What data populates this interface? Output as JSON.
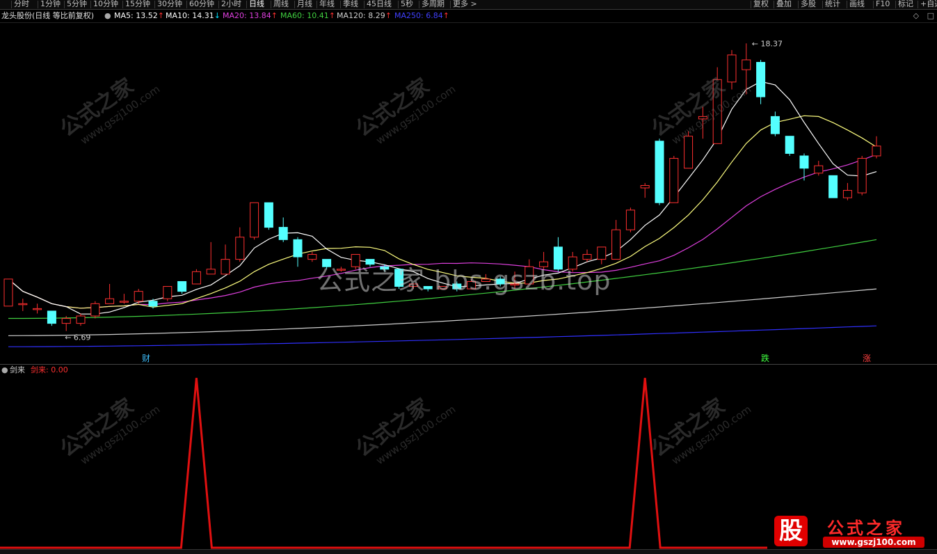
{
  "toolbar": {
    "periods": [
      {
        "label": "分时",
        "active": false
      },
      {
        "label": "1分钟",
        "active": false
      },
      {
        "label": "5分钟",
        "active": false
      },
      {
        "label": "10分钟",
        "active": false
      },
      {
        "label": "15分钟",
        "active": false
      },
      {
        "label": "30分钟",
        "active": false
      },
      {
        "label": "60分钟",
        "active": false
      },
      {
        "label": "2小时",
        "active": false
      },
      {
        "label": "日线",
        "active": true
      },
      {
        "label": "周线",
        "active": false
      },
      {
        "label": "月线",
        "active": false
      },
      {
        "label": "年线",
        "active": false
      },
      {
        "label": "季线",
        "active": false
      },
      {
        "label": "45日线",
        "active": false
      },
      {
        "label": "5秒",
        "active": false
      },
      {
        "label": "多周期",
        "active": false
      },
      {
        "label": "更多 >",
        "active": false
      }
    ],
    "right_items": [
      "复权",
      "叠加",
      "多股",
      "统计",
      "画线",
      "F10",
      "标记",
      "+自选"
    ]
  },
  "info": {
    "stock": "龙头股份(日线 等比前复权)",
    "ma": [
      {
        "label": "MA5: 13.52",
        "arrow": "↑",
        "dir": "up",
        "color": "#ffffff"
      },
      {
        "label": "MA10: 14.31",
        "arrow": "↓",
        "dir": "down",
        "color": "#ffffff"
      },
      {
        "label": "MA20: 13.84",
        "arrow": "↑",
        "dir": "up",
        "color": "#e040e0"
      },
      {
        "label": "MA60: 10.41",
        "arrow": "↑",
        "dir": "up",
        "color": "#40d040"
      },
      {
        "label": "MA120: 8.29",
        "arrow": "↑",
        "dir": "up",
        "color": "#d0d0d0"
      },
      {
        "label": "MA250: 6.84",
        "arrow": "↑",
        "dir": "up",
        "color": "#4040ff"
      }
    ]
  },
  "annotations": {
    "high": "18.37",
    "low": "6.69"
  },
  "markers": {
    "cai": "财",
    "die": "跌",
    "zhang": "涨"
  },
  "indicator": {
    "name": "剑来",
    "value_label": "剑来: 0.00"
  },
  "watermark": {
    "center": "公式之家 bbs.gszb.top",
    "tile_title": "公式之家",
    "tile_url": "www.gszj100.com"
  },
  "logo": {
    "badge": "股",
    "title": "公式之家",
    "url": "www.gszj100.com"
  },
  "colors": {
    "up": "#ff3030",
    "down": "#54ffff",
    "ma5": "#ffffff",
    "ma10": "#ffff80",
    "ma20": "#e040e0",
    "ma60": "#40d040",
    "ma120": "#d0d0d0",
    "ma250": "#3030ff",
    "indicator": "#e01010"
  },
  "chart_data": {
    "type": "candlestick",
    "price_range": [
      6.0,
      19.0
    ],
    "candles": [
      {
        "o": 7.7,
        "c": 8.8,
        "h": 8.8,
        "l": 7.7
      },
      {
        "o": 7.8,
        "c": 7.8,
        "h": 8.0,
        "l": 7.5
      },
      {
        "o": 7.6,
        "c": 7.6,
        "h": 7.8,
        "l": 7.4
      },
      {
        "o": 7.5,
        "c": 7.0,
        "h": 7.5,
        "l": 6.9
      },
      {
        "o": 7.0,
        "c": 7.2,
        "h": 7.3,
        "l": 6.69
      },
      {
        "o": 7.0,
        "c": 7.3,
        "h": 7.4,
        "l": 6.9
      },
      {
        "o": 7.3,
        "c": 7.8,
        "h": 7.9,
        "l": 7.2
      },
      {
        "o": 7.8,
        "c": 8.0,
        "h": 8.6,
        "l": 7.8
      },
      {
        "o": 7.9,
        "c": 7.9,
        "h": 8.2,
        "l": 7.8
      },
      {
        "o": 7.9,
        "c": 8.3,
        "h": 8.4,
        "l": 7.8
      },
      {
        "o": 7.9,
        "c": 7.7,
        "h": 8.0,
        "l": 7.6
      },
      {
        "o": 8.0,
        "c": 8.5,
        "h": 8.5,
        "l": 7.9
      },
      {
        "o": 8.7,
        "c": 8.3,
        "h": 8.7,
        "l": 8.2
      },
      {
        "o": 8.6,
        "c": 9.1,
        "h": 9.2,
        "l": 8.6
      },
      {
        "o": 9.0,
        "c": 9.2,
        "h": 10.3,
        "l": 9.0
      },
      {
        "o": 9.0,
        "c": 9.6,
        "h": 10.2,
        "l": 9.0
      },
      {
        "o": 9.6,
        "c": 10.5,
        "h": 10.9,
        "l": 9.5
      },
      {
        "o": 10.5,
        "c": 11.9,
        "h": 11.9,
        "l": 10.4
      },
      {
        "o": 11.9,
        "c": 10.9,
        "h": 11.9,
        "l": 10.8
      },
      {
        "o": 10.9,
        "c": 10.4,
        "h": 11.3,
        "l": 10.3
      },
      {
        "o": 10.4,
        "c": 9.7,
        "h": 10.5,
        "l": 9.3
      },
      {
        "o": 9.6,
        "c": 9.8,
        "h": 9.9,
        "l": 9.5
      },
      {
        "o": 9.6,
        "c": 9.3,
        "h": 9.6,
        "l": 9.2
      },
      {
        "o": 9.2,
        "c": 9.2,
        "h": 9.3,
        "l": 9.1
      },
      {
        "o": 9.3,
        "c": 9.8,
        "h": 9.8,
        "l": 9.2
      },
      {
        "o": 9.6,
        "c": 9.4,
        "h": 9.6,
        "l": 9.3
      },
      {
        "o": 9.3,
        "c": 9.2,
        "h": 9.4,
        "l": 9.1
      },
      {
        "o": 9.2,
        "c": 8.5,
        "h": 9.2,
        "l": 8.4
      },
      {
        "o": 8.5,
        "c": 8.6,
        "h": 8.6,
        "l": 8.4
      },
      {
        "o": 8.5,
        "c": 8.4,
        "h": 8.5,
        "l": 8.3
      },
      {
        "o": 8.4,
        "c": 8.5,
        "h": 8.5,
        "l": 8.4
      },
      {
        "o": 8.6,
        "c": 8.4,
        "h": 8.7,
        "l": 8.3
      },
      {
        "o": 8.4,
        "c": 8.7,
        "h": 8.8,
        "l": 8.4
      },
      {
        "o": 8.7,
        "c": 8.8,
        "h": 9.0,
        "l": 8.7
      },
      {
        "o": 8.8,
        "c": 8.6,
        "h": 8.9,
        "l": 8.5
      },
      {
        "o": 8.6,
        "c": 8.6,
        "h": 9.1,
        "l": 8.4
      },
      {
        "o": 8.6,
        "c": 9.3,
        "h": 9.6,
        "l": 8.6
      },
      {
        "o": 9.3,
        "c": 9.5,
        "h": 9.9,
        "l": 9.2
      },
      {
        "o": 10.1,
        "c": 9.2,
        "h": 10.5,
        "l": 9.1
      },
      {
        "o": 9.2,
        "c": 9.7,
        "h": 9.9,
        "l": 9.1
      },
      {
        "o": 9.6,
        "c": 9.8,
        "h": 10.0,
        "l": 9.5
      },
      {
        "o": 9.6,
        "c": 10.1,
        "h": 10.1,
        "l": 9.4
      },
      {
        "o": 9.6,
        "c": 10.8,
        "h": 11.2,
        "l": 9.6
      },
      {
        "o": 10.8,
        "c": 11.6,
        "h": 11.7,
        "l": 10.7
      },
      {
        "o": 12.5,
        "c": 12.6,
        "h": 12.7,
        "l": 12.1
      },
      {
        "o": 14.4,
        "c": 11.9,
        "h": 14.5,
        "l": 11.8
      },
      {
        "o": 11.9,
        "c": 13.7,
        "h": 13.8,
        "l": 11.9
      },
      {
        "o": 13.3,
        "c": 14.6,
        "h": 14.8,
        "l": 13.3
      },
      {
        "o": 15.3,
        "c": 15.4,
        "h": 15.8,
        "l": 14.5
      },
      {
        "o": 14.3,
        "c": 16.9,
        "h": 17.4,
        "l": 14.3
      },
      {
        "o": 16.8,
        "c": 17.9,
        "h": 18.1,
        "l": 16.5
      },
      {
        "o": 17.3,
        "c": 17.7,
        "h": 18.37,
        "l": 16.3
      },
      {
        "o": 17.6,
        "c": 16.2,
        "h": 17.7,
        "l": 15.9
      },
      {
        "o": 15.4,
        "c": 14.7,
        "h": 15.6,
        "l": 14.6
      },
      {
        "o": 14.6,
        "c": 13.9,
        "h": 14.6,
        "l": 13.8
      },
      {
        "o": 13.8,
        "c": 13.3,
        "h": 13.9,
        "l": 12.8
      },
      {
        "o": 13.1,
        "c": 13.4,
        "h": 13.6,
        "l": 13.0
      },
      {
        "o": 13.0,
        "c": 12.1,
        "h": 13.0,
        "l": 12.1
      },
      {
        "o": 12.1,
        "c": 12.4,
        "h": 12.7,
        "l": 12.0
      },
      {
        "o": 12.3,
        "c": 13.7,
        "h": 13.8,
        "l": 12.2
      },
      {
        "o": 13.8,
        "c": 14.2,
        "h": 14.6,
        "l": 13.7
      }
    ],
    "indicator_series": {
      "name": "剑来",
      "range": [
        0,
        1
      ],
      "spikes_at_candle": [
        13,
        44
      ],
      "values_note": "0 except 1 at spike candles"
    }
  }
}
